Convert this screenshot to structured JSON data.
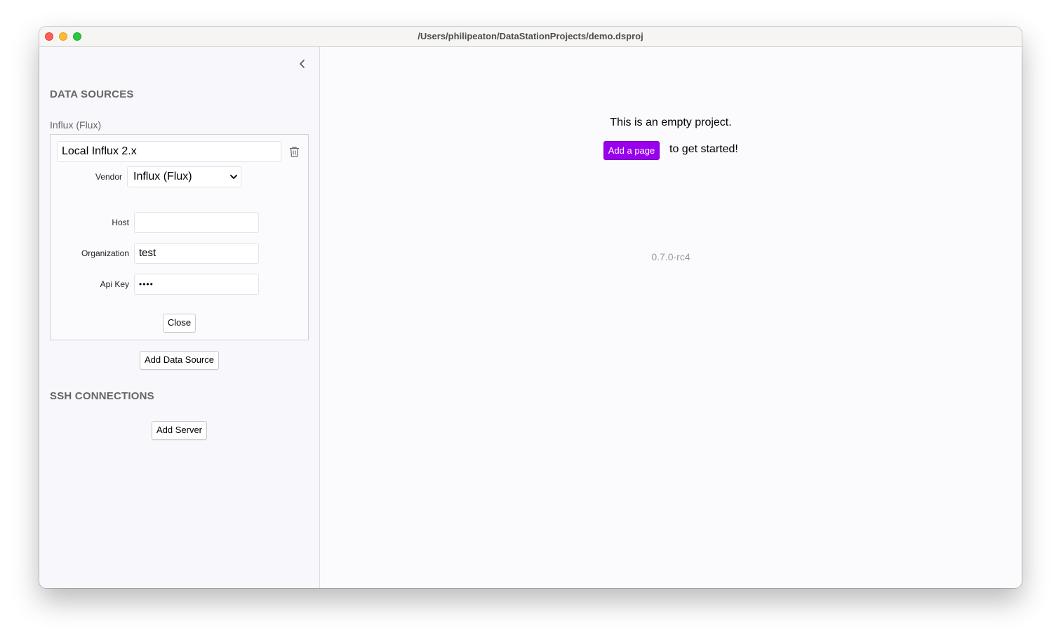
{
  "window": {
    "title": "/Users/philipeaton/DataStationProjects/demo.dsproj"
  },
  "sidebar": {
    "collapse_icon": "chevron-left-icon",
    "data_sources_title": "DATA SOURCES",
    "data_source": {
      "type_label": "Influx (Flux)",
      "name_value": "Local Influx 2.x",
      "delete_icon": "trash-icon",
      "vendor_label": "Vendor",
      "vendor_selected": "Influx (Flux)",
      "host_label": "Host",
      "host_value": "",
      "organization_label": "Organization",
      "organization_value": "test",
      "api_key_label": "Api Key",
      "api_key_value": "••••",
      "close_button": "Close"
    },
    "add_data_source_button": "Add Data Source",
    "ssh_title": "SSH CONNECTIONS",
    "add_server_button": "Add Server"
  },
  "main": {
    "empty_message": "This is an empty project.",
    "add_page_button": "Add a page",
    "get_started_text": "to get started!",
    "version": "0.7.0-rc4",
    "accent_color": "#9900ee"
  }
}
